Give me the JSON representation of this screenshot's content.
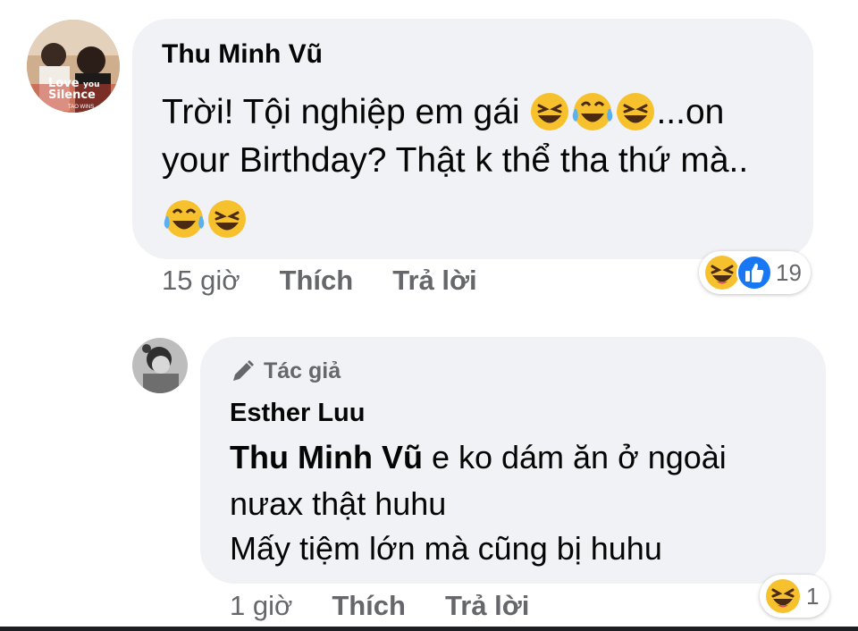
{
  "comment1": {
    "author": "Thu Minh Vũ",
    "line1_text": "Trời! Tội nghiệp em gái ",
    "line1_after": "...on",
    "line2": "your Birthday? Thật k thể tha thứ mà..",
    "avatar_text": {
      "top": "Love",
      "mid": "you",
      "bottom": "Silence",
      "small": "TAO WINS"
    },
    "time": "15 giờ",
    "like_label": "Thích",
    "reply_label": "Trả lời",
    "reaction_count": "19"
  },
  "comment2": {
    "badge_label": "Tác giả",
    "author": "Esther Luu",
    "mention": "Thu Minh Vũ",
    "line1_rest": " e ko dám ăn ở ngoài",
    "line2": "nưax thật huhu",
    "line3": "Mấy tiệm lớn mà cũng bị huhu",
    "time": "1 giờ",
    "like_label": "Thích",
    "reply_label": "Trả lời",
    "reaction_count": "1"
  },
  "colors": {
    "bubble": "#f0f2f5",
    "meta_text": "#65676b",
    "like_blue": "#1877f2",
    "emoji_yellow": "#f7c12e"
  },
  "icons": [
    "laughing-emoji-icon",
    "tears-of-joy-emoji-icon",
    "like-reaction-icon",
    "haha-reaction-icon",
    "pen-icon"
  ]
}
